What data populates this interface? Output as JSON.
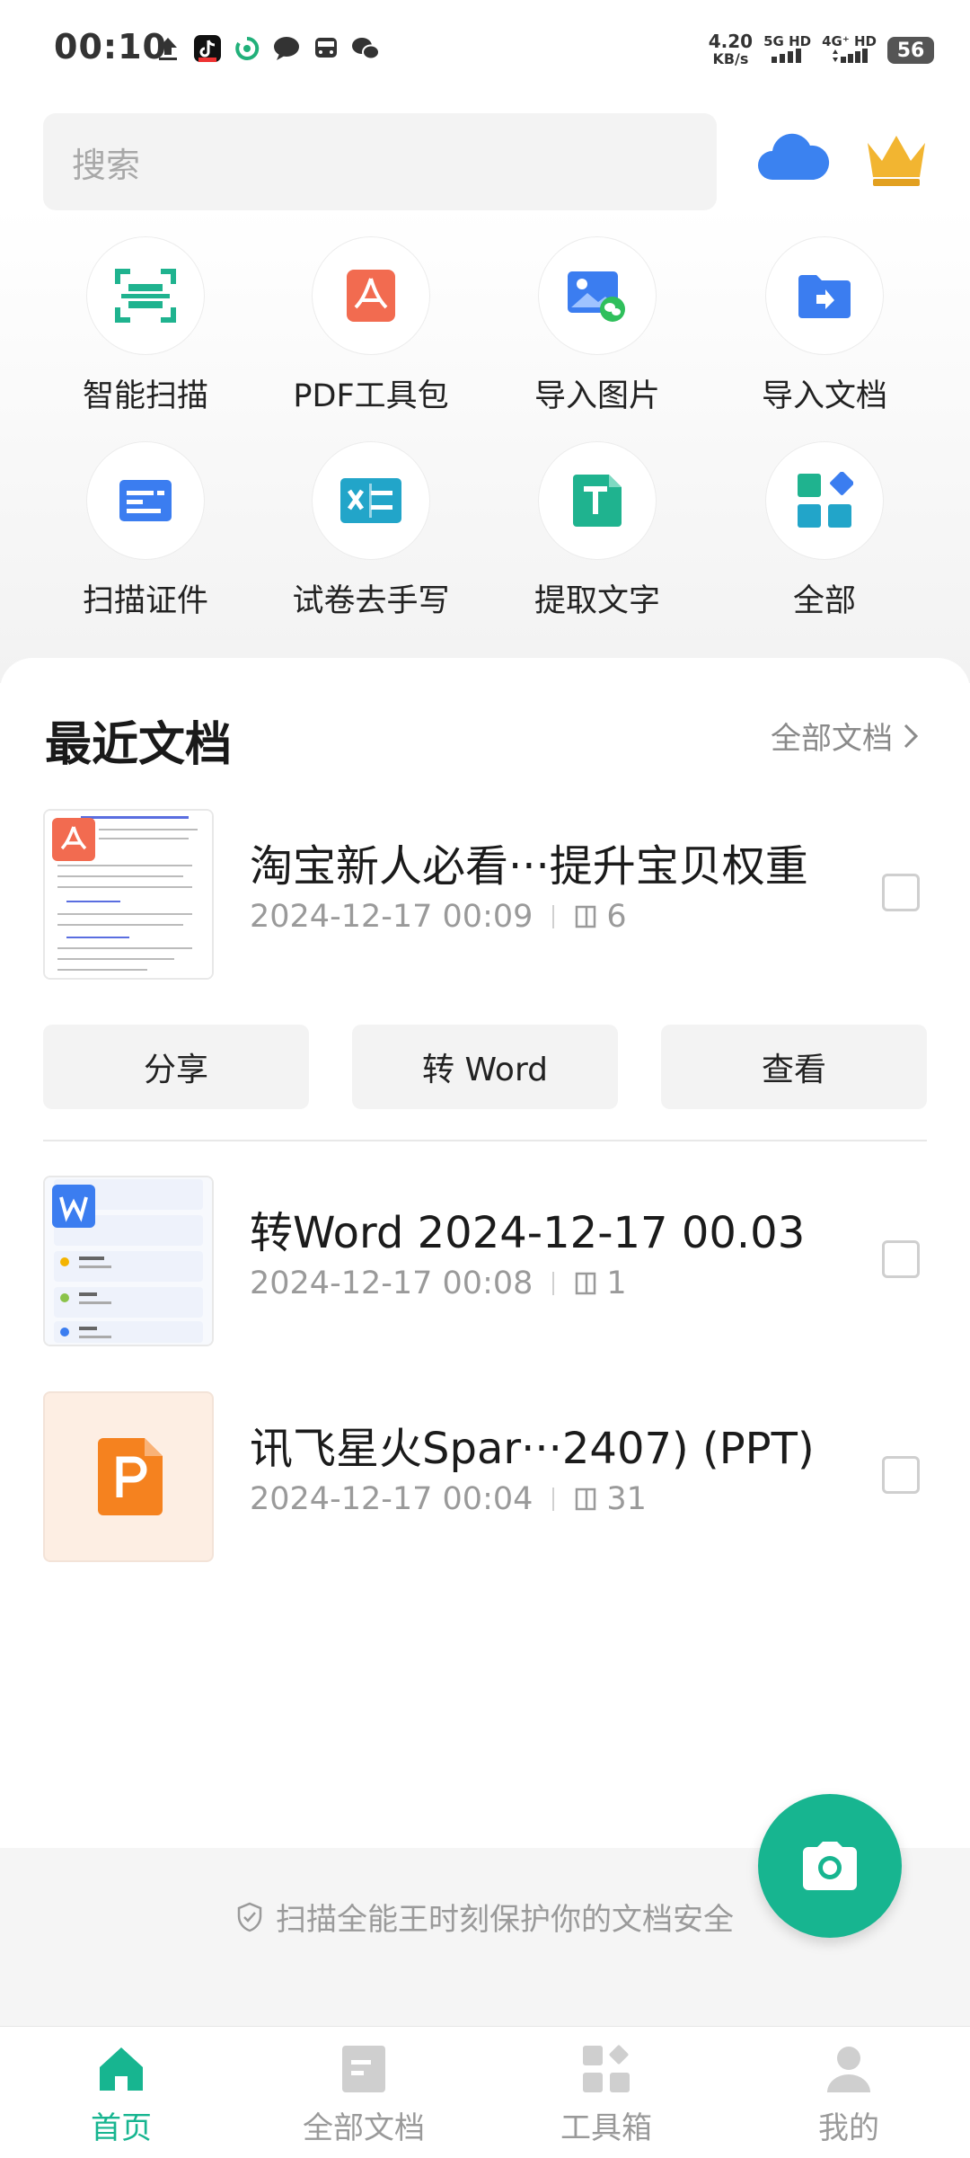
{
  "status_bar": {
    "time": "00:10",
    "speed_value": "4.20",
    "speed_unit": "KB/s",
    "signal_1": "5G HD",
    "signal_2": "4G⁺ HD",
    "battery": "56"
  },
  "search": {
    "placeholder": "搜索"
  },
  "tools": [
    {
      "label": "智能扫描",
      "icon": "scan-icon"
    },
    {
      "label": "PDF工具包",
      "icon": "pdf-icon"
    },
    {
      "label": "导入图片",
      "icon": "import-image-icon"
    },
    {
      "label": "导入文档",
      "icon": "import-folder-icon"
    },
    {
      "label": "扫描证件",
      "icon": "id-card-icon"
    },
    {
      "label": "试卷去手写",
      "icon": "exam-clean-icon"
    },
    {
      "label": "提取文字",
      "icon": "text-extract-icon"
    },
    {
      "label": "全部",
      "icon": "all-apps-icon"
    }
  ],
  "recent": {
    "title": "最近文档",
    "all_link": "全部文档"
  },
  "docs": [
    {
      "title": "淘宝新人必看···提升宝贝权重",
      "date": "2024-12-17 00:09",
      "pages": "6",
      "badge": "pdf"
    },
    {
      "title": "转Word 2024-12-17 00.03",
      "date": "2024-12-17 00:08",
      "pages": "1",
      "badge": "word"
    },
    {
      "title": "讯飞星火Spar···2407) (PPT)",
      "date": "2024-12-17 00:04",
      "pages": "31",
      "badge": "ppt"
    }
  ],
  "actions": {
    "share": "分享",
    "to_word": "转 Word",
    "view": "查看"
  },
  "security": "扫描全能王时刻保护你的文档安全",
  "nav": [
    {
      "label": "首页",
      "active": true
    },
    {
      "label": "全部文档",
      "active": false
    },
    {
      "label": "工具箱",
      "active": false
    },
    {
      "label": "我的",
      "active": false
    }
  ],
  "colors": {
    "accent": "#17b590",
    "pdf": "#f26b50",
    "word": "#3b7df0",
    "ppt": "#f5821f"
  }
}
